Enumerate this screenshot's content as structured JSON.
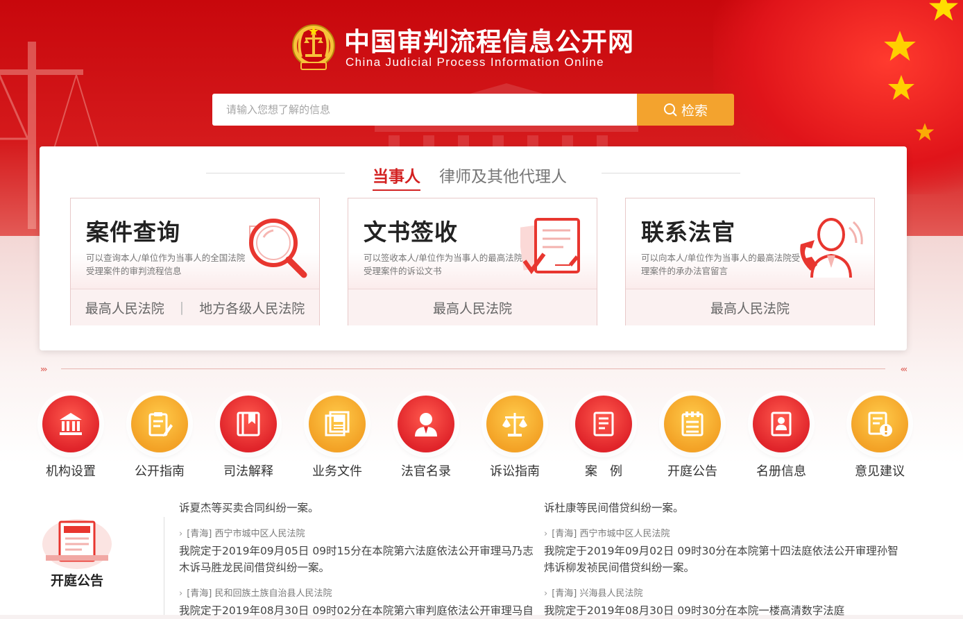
{
  "header": {
    "title_cn": "中国审判流程信息公开网",
    "title_en": "China Judicial Process Information Online"
  },
  "search": {
    "placeholder": "请输入您想了解的信息",
    "button_label": "检索"
  },
  "tabs": [
    {
      "label": "当事人",
      "active": true
    },
    {
      "label": "律师及其他代理人",
      "active": false
    }
  ],
  "cards": [
    {
      "title": "案件查询",
      "desc": "可以查询本人/单位作为当事人的全国法院受理案件的审判流程信息",
      "icon": "magnifier-icon",
      "links": [
        "最高人民法院",
        "地方各级人民法院"
      ],
      "separator": "|"
    },
    {
      "title": "文书签收",
      "desc": "可以签收本人/单位作为当事人的最高法院受理案件的诉讼文书",
      "icon": "document-sign-icon",
      "links": [
        "最高人民法院"
      ]
    },
    {
      "title": "联系法官",
      "desc": "可以向本人/单位作为当事人的最高法院受理案件的承办法官留言",
      "icon": "judge-phone-icon",
      "links": [
        "最高人民法院"
      ]
    }
  ],
  "nav": [
    {
      "label": "机构设置",
      "icon": "court-building-icon",
      "color": "red"
    },
    {
      "label": "公开指南",
      "icon": "clipboard-edit-icon",
      "color": "yellow"
    },
    {
      "label": "司法解释",
      "icon": "book-bookmark-icon",
      "color": "red"
    },
    {
      "label": "业务文件",
      "icon": "files-icon",
      "color": "yellow"
    },
    {
      "label": "法官名录",
      "icon": "judge-person-icon",
      "color": "red"
    },
    {
      "label": "诉讼指南",
      "icon": "scales-icon",
      "color": "yellow"
    },
    {
      "label": "案　例",
      "icon": "case-book-icon",
      "color": "red"
    },
    {
      "label": "开庭公告",
      "icon": "announcement-list-icon",
      "color": "yellow"
    },
    {
      "label": "名册信息",
      "icon": "roster-icon",
      "color": "red"
    },
    {
      "label": "意见建议",
      "icon": "feedback-icon",
      "color": "yellow"
    }
  ],
  "notice_section": {
    "label": "开庭公告"
  },
  "announcements": {
    "left": [
      {
        "court": "",
        "text": "诉夏杰等买卖合同纠纷一案。"
      },
      {
        "court": "[青海]  西宁市城中区人民法院",
        "text": "我院定于2019年09月05日 09时15分在本院第六法庭依法公开审理马乃志木诉马胜龙民间借贷纠纷一案。"
      },
      {
        "court": "[青海]  民和回族土族自治县人民法院",
        "text": "我院定于2019年08月30日 09时02分在本院第六审判庭依法公开审理马自"
      }
    ],
    "right": [
      {
        "court": "",
        "text": "诉杜康等民间借贷纠纷一案。"
      },
      {
        "court": "[青海]  西宁市城中区人民法院",
        "text": "我院定于2019年09月02日 09时30分在本院第十四法庭依法公开审理孙智炜诉柳发祯民间借贷纠纷一案。"
      },
      {
        "court": "[青海]  兴海县人民法院",
        "text": "我院定于2019年08月30日 09时30分在本院一楼高清数字法庭"
      }
    ]
  },
  "colors": {
    "brand_red": "#c8070c",
    "accent_orange": "#f3a32e",
    "tab_active": "#d32121"
  }
}
